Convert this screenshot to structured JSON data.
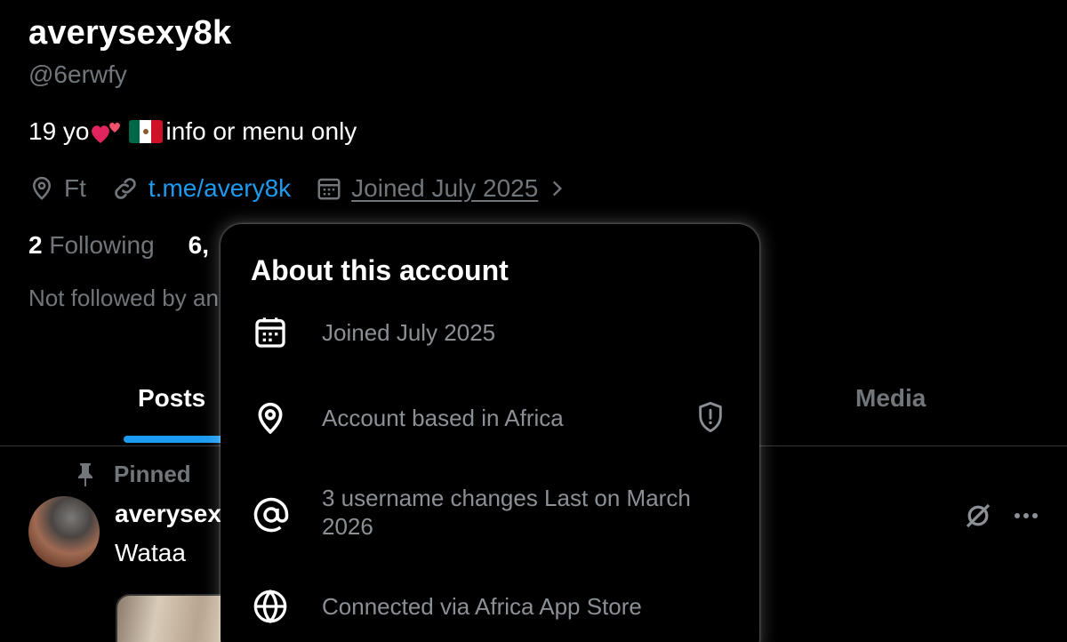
{
  "profile": {
    "display_name": "averysexy8k",
    "handle": "@6erwfy",
    "bio_start": "19 yo",
    "bio_end": "info or menu only",
    "location": "Ft",
    "link": "t.me/avery8k",
    "joined": "Joined July 2025",
    "following_count": "2",
    "following_label": "Following",
    "followers_count_partial": "6,",
    "followed_by_partial": "Not followed by an"
  },
  "tabs": {
    "posts": "Posts",
    "media": "Media"
  },
  "post": {
    "pinned_label": "Pinned",
    "author_partial": "averysex",
    "text_partial": "Wataa"
  },
  "about_popover": {
    "title": "About this account",
    "rows": [
      {
        "icon": "calendar-icon",
        "text": "Joined July 2025"
      },
      {
        "icon": "location-pin-icon",
        "text": "Account based in Africa"
      },
      {
        "icon": "at-sign-icon",
        "text": "3 username changes Last on March 2026"
      },
      {
        "icon": "globe-icon",
        "text": "Connected via Africa App Store"
      }
    ]
  },
  "colors": {
    "accent": "#1d9bf0",
    "muted_text": "#71767b",
    "background": "#000000"
  }
}
